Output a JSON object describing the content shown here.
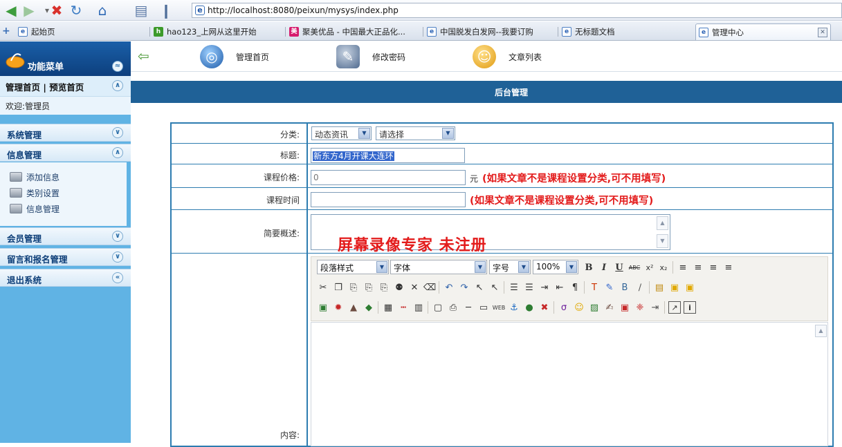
{
  "browser": {
    "url": "http://localhost:8080/peixun/mysys/index.php",
    "tabs": [
      {
        "label": "起始页"
      },
      {
        "label": "hao123_上网从这里开始",
        "favicon": "hao"
      },
      {
        "label": "聚美优品 - 中国最大正品化...",
        "favicon": "美"
      },
      {
        "label": "中国脱发白发网--我要订购"
      },
      {
        "label": "无标题文档"
      },
      {
        "label": "管理中心",
        "active": true
      }
    ]
  },
  "sidebar": {
    "menu_title": "功能菜单",
    "home_links": "管理首页 | 预览首页",
    "welcome": "欢迎:管理员",
    "sections": [
      {
        "label": "系统管理"
      },
      {
        "label": "信息管理"
      },
      {
        "label": "会员管理"
      },
      {
        "label": "留言和报名管理"
      },
      {
        "label": "退出系统"
      }
    ],
    "info_items": [
      {
        "label": "添加信息"
      },
      {
        "label": "类别设置"
      },
      {
        "label": "信息管理"
      }
    ]
  },
  "topnav": {
    "items": [
      {
        "label": "管理首页",
        "icon": "globe-icon"
      },
      {
        "label": "修改密码",
        "icon": "password-icon"
      },
      {
        "label": "文章列表",
        "icon": "user-icon"
      }
    ]
  },
  "admin_title": "后台管理",
  "form": {
    "category_label": "分类:",
    "category_value": "动态资讯",
    "subcategory_value": "请选择",
    "title_label": "标题:",
    "title_value": "新东方4月开课大连环",
    "price_label": "课程价格:",
    "price_value": "0",
    "price_unit": "元",
    "price_note": "(如果文章不是课程设置分类,可不用填写)",
    "time_label": "课程时间",
    "time_note": "(如果文章不是课程设置分类,可不用填写)",
    "summary_label": "简要概述:",
    "content_label": "内容:"
  },
  "editor": {
    "paragraph_style": "段落样式",
    "font": "字体",
    "font_size": "字号",
    "zoom": "100%"
  },
  "watermark": "屏幕录像专家 未注册"
}
